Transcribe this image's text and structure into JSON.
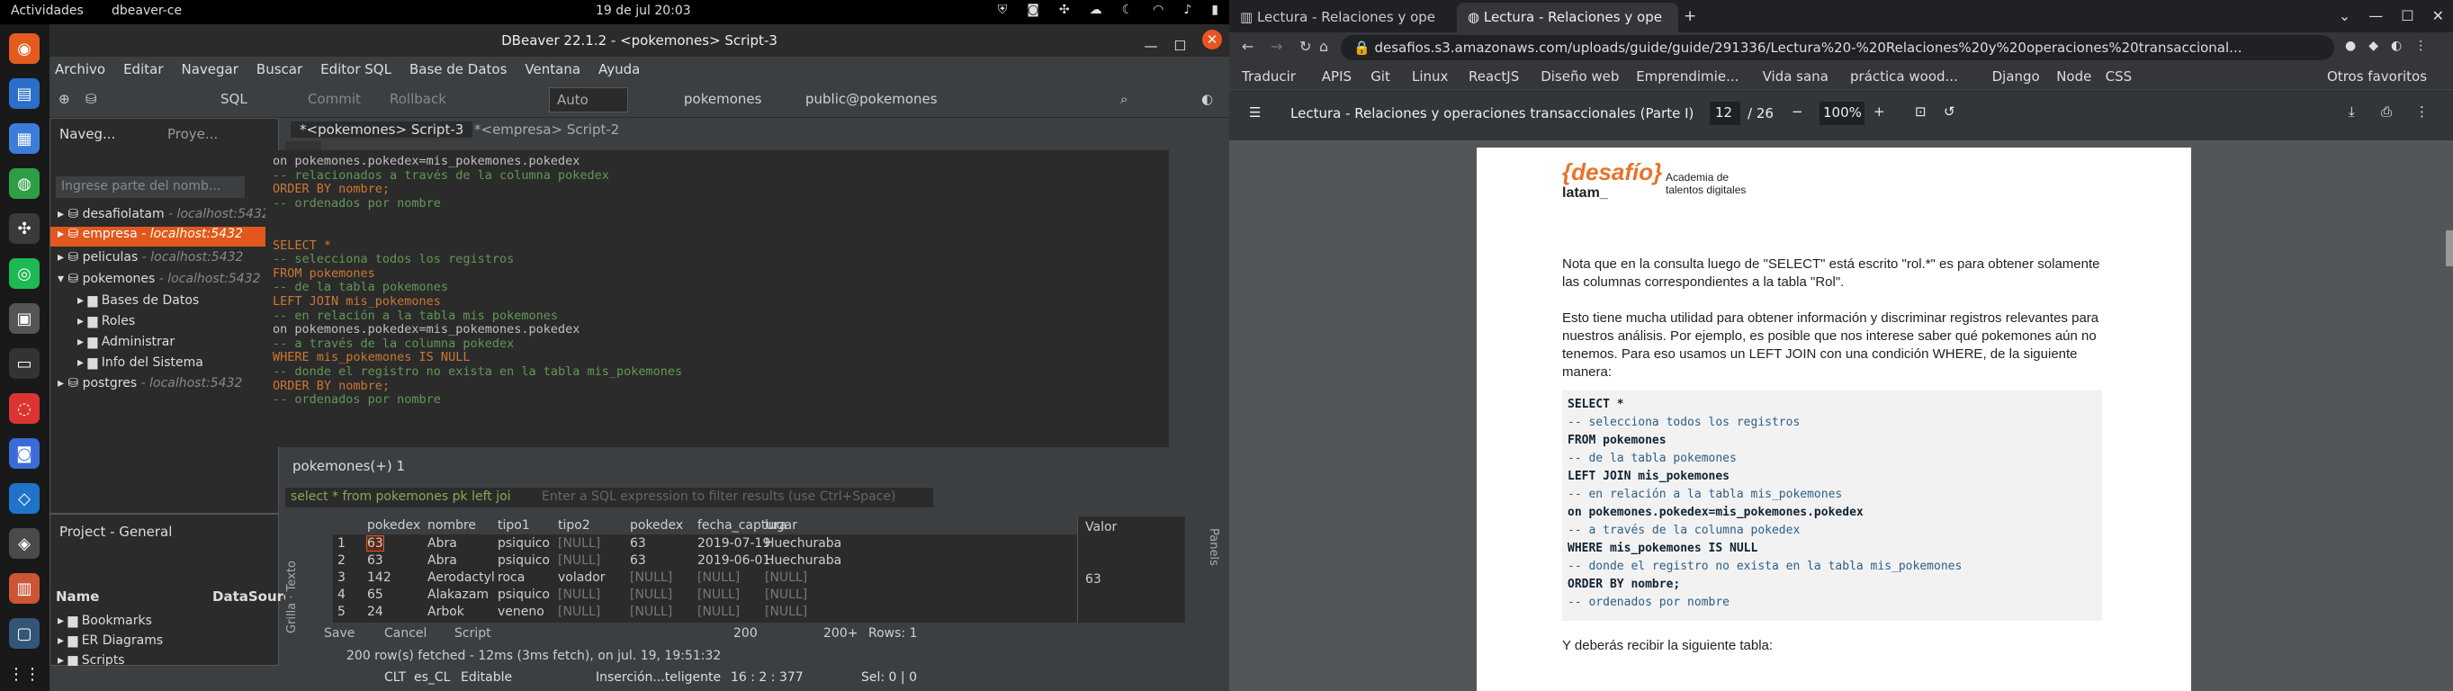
{
  "topbar": {
    "activities": "Actividades",
    "app": "dbeaver-ce",
    "clock": "19 de jul  20:03"
  },
  "dbeaver": {
    "title": "DBeaver 22.1.2 - <pokemones> Script-3",
    "menu": [
      "Archivo",
      "Editar",
      "Navegar",
      "Buscar",
      "Editor SQL",
      "Base de Datos",
      "Ventana",
      "Ayuda"
    ],
    "toolbar": {
      "sql": "SQL",
      "commit": "Commit",
      "rollback": "Rollback",
      "auto": "Auto",
      "db": "pokemones",
      "schema": "public@pokemones"
    },
    "nav": {
      "tab1": "Naveg...",
      "tab2": "Proye...",
      "filter": "Ingrese parte del nomb...",
      "items": [
        {
          "label": "desafiolatam",
          "host": " - localhost:5432"
        },
        {
          "label": "empresa",
          "host": " - localhost:5432"
        },
        {
          "label": "peliculas",
          "host": " - localhost:5432"
        },
        {
          "label": "pokemones",
          "host": " - localhost:5432"
        },
        {
          "label": "Bases de Datos",
          "host": ""
        },
        {
          "label": "Roles",
          "host": ""
        },
        {
          "label": "Administrar",
          "host": ""
        },
        {
          "label": "Info del Sistema",
          "host": ""
        },
        {
          "label": "postgres",
          "host": " - localhost:5432"
        }
      ]
    },
    "project": {
      "tab": "Project - General",
      "col1": "Name",
      "col2": "DataSourc",
      "items": [
        "Bookmarks",
        "ER Diagrams",
        "Scripts"
      ]
    },
    "editor": {
      "tab1": "*<pokemones> Script-3",
      "tab2": "*<empresa> Script-2",
      "lines": [
        {
          "t": "on pokemones.pokedex=mis_pokemones.pokedex",
          "c": "tx"
        },
        {
          "t": "-- relacionados a través de la columna pokedex",
          "c": "cm"
        },
        {
          "t": "ORDER BY nombre;",
          "c": "kw"
        },
        {
          "t": "-- ordenados por nombre",
          "c": "cm"
        },
        {
          "t": "",
          "c": "tx"
        },
        {
          "t": "",
          "c": "tx"
        },
        {
          "t": "SELECT *",
          "c": "kw"
        },
        {
          "t": "-- selecciona todos los registros",
          "c": "cm"
        },
        {
          "t": "FROM pokemones",
          "c": "kw"
        },
        {
          "t": "-- de la tabla pokemones",
          "c": "cm"
        },
        {
          "t": "LEFT JOIN mis_pokemones",
          "c": "kw"
        },
        {
          "t": "-- en relación a la tabla mis pokemones",
          "c": "cm"
        },
        {
          "t": "on pokemones.pokedex=mis_pokemones.pokedex",
          "c": "tx"
        },
        {
          "t": "-- a través de la columna pokedex",
          "c": "cm"
        },
        {
          "t": "WHERE mis_pokemones IS NULL",
          "c": "kw"
        },
        {
          "t": "-- donde el registro no exista en la tabla mis_pokemones",
          "c": "cm"
        },
        {
          "t": "ORDER BY nombre;",
          "c": "kw"
        },
        {
          "t": "-- ordenados por nombre",
          "c": "cm"
        }
      ]
    },
    "results": {
      "tab": "pokemones(+) 1",
      "query": "select * from pokemones pk left joi",
      "filter_placeholder": "Enter a SQL expression to filter results (use Ctrl+Space)",
      "headers": [
        "pokedex",
        "nombre",
        "tipo1",
        "tipo2",
        "pokedex",
        "fecha_captura",
        "lugar"
      ],
      "rows": [
        [
          "1",
          "63",
          "Abra",
          "psiquico",
          "[NULL]",
          "63",
          "2019-07-19",
          "Huechuraba"
        ],
        [
          "2",
          "63",
          "Abra",
          "psiquico",
          "[NULL]",
          "63",
          "2019-06-01",
          "Huechuraba"
        ],
        [
          "3",
          "142",
          "Aerodactyl",
          "roca",
          "volador",
          "[NULL]",
          "[NULL]",
          "[NULL]"
        ],
        [
          "4",
          "65",
          "Alakazam",
          "psiquico",
          "[NULL]",
          "[NULL]",
          "[NULL]",
          "[NULL]"
        ],
        [
          "5",
          "24",
          "Arbok",
          "veneno",
          "[NULL]",
          "[NULL]",
          "[NULL]",
          "[NULL]"
        ]
      ],
      "value_tab": "Valor",
      "value": "63",
      "save": "Save",
      "cancel": "Cancel",
      "script": "Script",
      "limit": "200",
      "limit2": "200+",
      "rows_label": "Rows: 1",
      "fetched": "200 row(s) fetched - 12ms (3ms fetch), on jul. 19, 19:51:32",
      "side": [
        "Grilla",
        "Texto"
      ],
      "panels": "Panels"
    },
    "status": {
      "tz": "CLT",
      "locale": "es_CL",
      "mode": "Editable",
      "insert": "Inserción...teligente",
      "pos": "16 : 2 : 377",
      "sel": "Sel: 0 | 0"
    }
  },
  "chrome": {
    "tabs": [
      "Lectura - Relaciones y ope",
      "Lectura - Relaciones y ope"
    ],
    "url": "desafios.s3.amazonaws.com/uploads/guide/guide/291336/Lectura%20-%20Relaciones%20y%20operaciones%20transaccional...",
    "bookmarks": [
      "Traducir",
      "APIS",
      "Git",
      "Linux",
      "ReactJS",
      "Diseño web",
      "Emprendimie...",
      "Vida sana",
      "práctica wood...",
      "Django",
      "Node",
      "CSS",
      "Otros favoritos"
    ],
    "pdf": {
      "title": "Lectura - Relaciones y operaciones transaccionales (Parte I)",
      "page": "12",
      "total": "/ 26",
      "zoom": "100%"
    },
    "doc": {
      "logo": "{desafío}",
      "logo2": "latam_",
      "tagline1": "Academia de",
      "tagline2": "talentos digitales",
      "p1": "Nota que en la consulta luego de \"SELECT\" está escrito \"rol.*\" es para obtener solamente las columnas correspondientes a la tabla \"Rol\".",
      "p2": "Esto tiene mucha utilidad para obtener información y discriminar registros relevantes para nuestros análisis. Por ejemplo, es posible que nos interese saber qué pokemones aún no tenemos. Para eso usamos un LEFT JOIN con una condición WHERE, de la siguiente manera:",
      "code": [
        {
          "t": "SELECT *",
          "c": "k2"
        },
        {
          "t": "-- selecciona todos los registros",
          "c": "cmt"
        },
        {
          "t": "FROM pokemones",
          "c": "k2"
        },
        {
          "t": "-- de la tabla pokemones",
          "c": "cmt"
        },
        {
          "t": "LEFT JOIN mis_pokemones",
          "c": "k2"
        },
        {
          "t": "-- en relación a la tabla mis_pokemones",
          "c": "cmt"
        },
        {
          "t": "on pokemones.pokedex=mis_pokemones.pokedex",
          "c": "k2"
        },
        {
          "t": "-- a través de la columna pokedex",
          "c": "cmt"
        },
        {
          "t": "WHERE mis_pokemones IS NULL",
          "c": "k2"
        },
        {
          "t": "-- donde el registro no exista en la tabla mis_pokemones",
          "c": "cmt"
        },
        {
          "t": "ORDER BY nombre;",
          "c": "k2"
        },
        {
          "t": "-- ordenados por nombre",
          "c": "cmt"
        }
      ],
      "p3": "Y deberás recibir la siguiente tabla:"
    }
  }
}
